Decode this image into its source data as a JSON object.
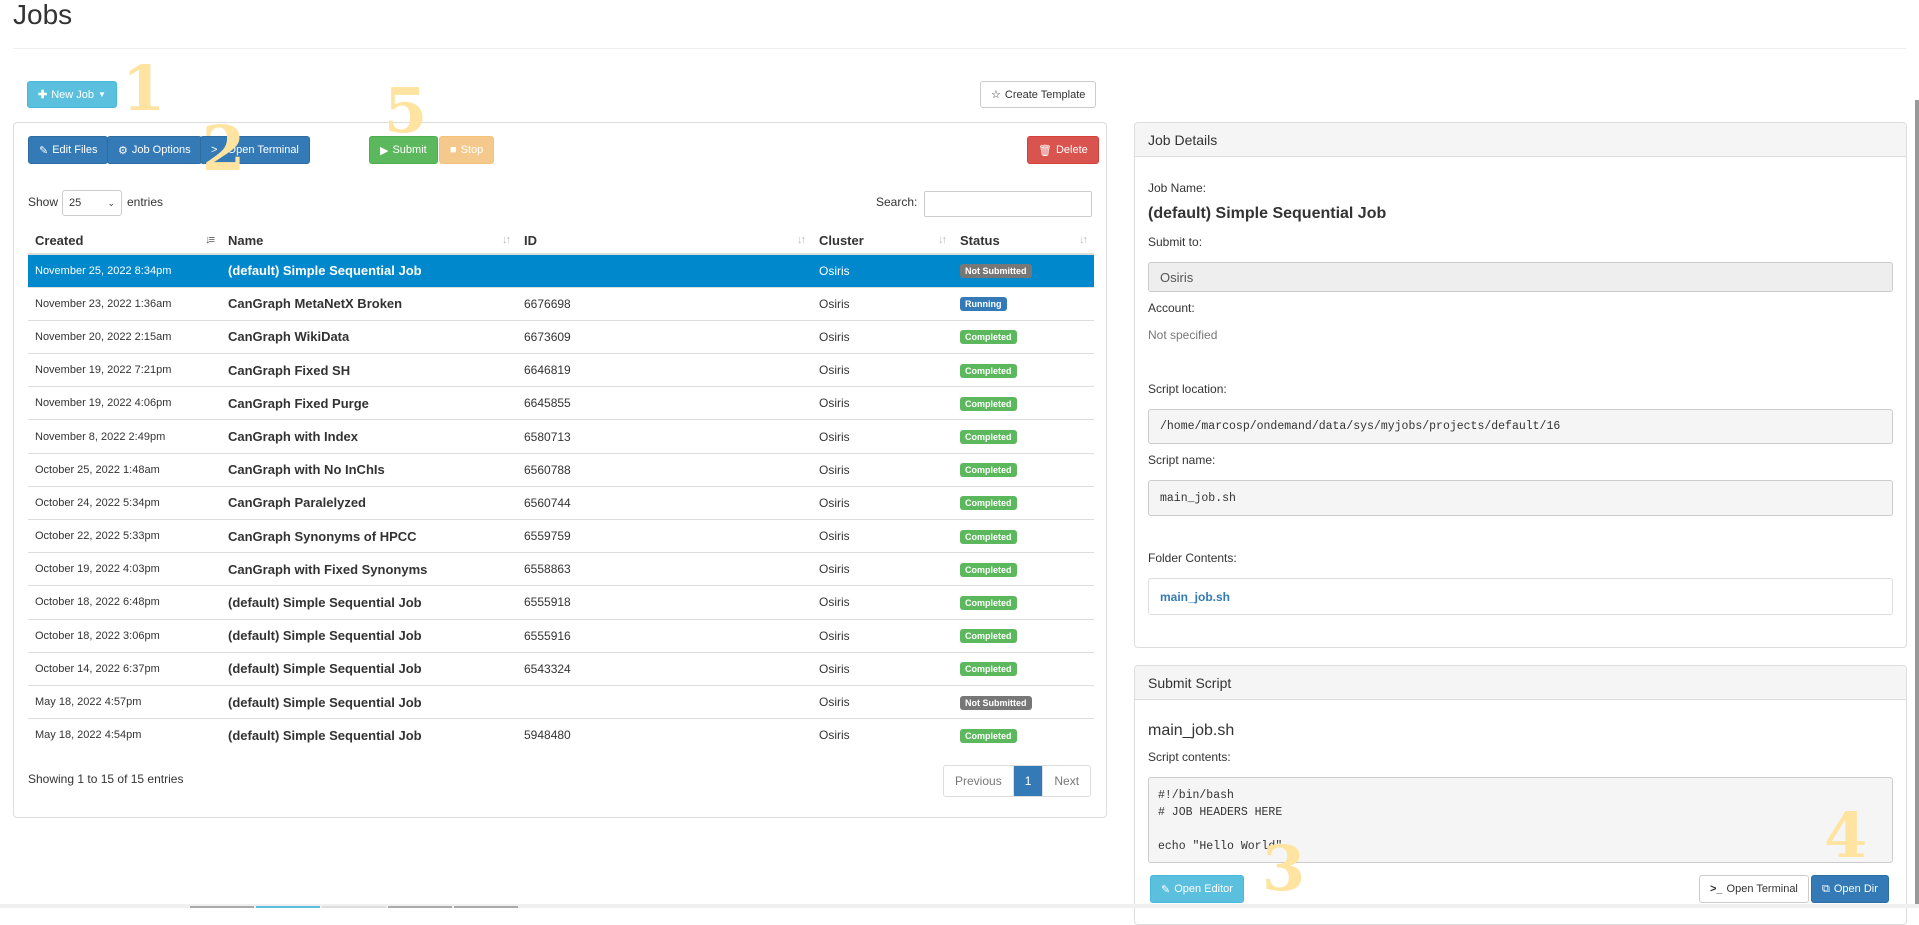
{
  "page": {
    "title": "Jobs"
  },
  "toolbar": {
    "new_job": "New Job",
    "create_template": "Create Template",
    "edit_files": "Edit Files",
    "job_options": "Job Options",
    "open_terminal": "Open Terminal",
    "submit": "Submit",
    "stop": "Stop",
    "delete": "Delete"
  },
  "annotations": [
    "1",
    "2",
    "3",
    "4",
    "5"
  ],
  "table_controls": {
    "show_label": "Show",
    "entries_label": "entries",
    "page_size": "25",
    "search_label": "Search:",
    "search_value": ""
  },
  "table": {
    "columns": [
      "Created",
      "Name",
      "ID",
      "Cluster",
      "Status"
    ],
    "rows": [
      {
        "created": "November 25, 2022 8:34pm",
        "name": "(default) Simple Sequential Job",
        "id": "",
        "cluster": "Osiris",
        "status": "Not Submitted",
        "selected": true
      },
      {
        "created": "November 23, 2022 1:36am",
        "name": "CanGraph MetaNetX Broken",
        "id": "6676698",
        "cluster": "Osiris",
        "status": "Running"
      },
      {
        "created": "November 20, 2022 2:15am",
        "name": "CanGraph WikiData",
        "id": "6673609",
        "cluster": "Osiris",
        "status": "Completed"
      },
      {
        "created": "November 19, 2022 7:21pm",
        "name": "CanGraph Fixed SH",
        "id": "6646819",
        "cluster": "Osiris",
        "status": "Completed"
      },
      {
        "created": "November 19, 2022 4:06pm",
        "name": "CanGraph Fixed Purge",
        "id": "6645855",
        "cluster": "Osiris",
        "status": "Completed"
      },
      {
        "created": "November 8, 2022 2:49pm",
        "name": "CanGraph with Index",
        "id": "6580713",
        "cluster": "Osiris",
        "status": "Completed"
      },
      {
        "created": "October 25, 2022 1:48am",
        "name": "CanGraph with No InChIs",
        "id": "6560788",
        "cluster": "Osiris",
        "status": "Completed"
      },
      {
        "created": "October 24, 2022 5:34pm",
        "name": "CanGraph Paralelyzed",
        "id": "6560744",
        "cluster": "Osiris",
        "status": "Completed"
      },
      {
        "created": "October 22, 2022 5:33pm",
        "name": "CanGraph Synonyms of HPCC",
        "id": "6559759",
        "cluster": "Osiris",
        "status": "Completed"
      },
      {
        "created": "October 19, 2022 4:03pm",
        "name": "CanGraph with Fixed Synonyms",
        "id": "6558863",
        "cluster": "Osiris",
        "status": "Completed"
      },
      {
        "created": "October 18, 2022 6:48pm",
        "name": "(default) Simple Sequential Job",
        "id": "6555918",
        "cluster": "Osiris",
        "status": "Completed"
      },
      {
        "created": "October 18, 2022 3:06pm",
        "name": "(default) Simple Sequential Job",
        "id": "6555916",
        "cluster": "Osiris",
        "status": "Completed"
      },
      {
        "created": "October 14, 2022 6:37pm",
        "name": "(default) Simple Sequential Job",
        "id": "6543324",
        "cluster": "Osiris",
        "status": "Completed"
      },
      {
        "created": "May 18, 2022 4:57pm",
        "name": "(default) Simple Sequential Job",
        "id": "",
        "cluster": "Osiris",
        "status": "Not Submitted"
      },
      {
        "created": "May 18, 2022 4:54pm",
        "name": "(default) Simple Sequential Job",
        "id": "5948480",
        "cluster": "Osiris",
        "status": "Completed"
      }
    ],
    "info": "Showing 1 to 15 of 15 entries",
    "pagination": {
      "previous": "Previous",
      "current": "1",
      "next": "Next"
    }
  },
  "job_details": {
    "heading": "Job Details",
    "job_name_label": "Job Name:",
    "job_name": "(default) Simple Sequential Job",
    "submit_to_label": "Submit to:",
    "submit_to": "Osiris",
    "account_label": "Account:",
    "account": "Not specified",
    "script_location_label": "Script location:",
    "script_location": "/home/marcosp/ondemand/data/sys/myjobs/projects/default/16",
    "script_name_label": "Script name:",
    "script_name": "main_job.sh",
    "folder_contents_label": "Folder Contents:",
    "folder_contents": [
      "main_job.sh"
    ]
  },
  "submit_script": {
    "heading": "Submit Script",
    "filename": "main_job.sh",
    "contents_label": "Script contents:",
    "contents": "#!/bin/bash\n# JOB HEADERS HERE\n\necho \"Hello World\"",
    "open_editor": "Open Editor",
    "open_terminal": "Open Terminal",
    "open_dir": "Open Dir"
  },
  "colors": {
    "selected_row": "#0088cc",
    "primary": "#337ab7",
    "info": "#5bc0de",
    "success": "#5cb85c",
    "warning": "#f0ad4e",
    "danger": "#d9534f",
    "annotation": "#ffe3a0"
  }
}
